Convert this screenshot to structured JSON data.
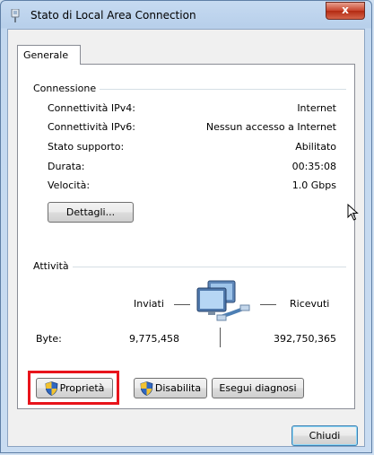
{
  "window": {
    "title": "Stato di Local Area Connection",
    "close_symbol": "x"
  },
  "tab": {
    "label": "Generale"
  },
  "connection": {
    "group_label": "Connessione",
    "rows": [
      {
        "label": "Connettività IPv4:",
        "value": "Internet"
      },
      {
        "label": "Connettività IPv6:",
        "value": "Nessun accesso a Internet"
      },
      {
        "label": "Stato supporto:",
        "value": "Abilitato"
      },
      {
        "label": "Durata:",
        "value": "00:35:08"
      },
      {
        "label": "Velocità:",
        "value": "1.0 Gbps"
      }
    ],
    "details_button": "Dettagli..."
  },
  "activity": {
    "group_label": "Attività",
    "sent_label": "Inviati",
    "received_label": "Ricevuti",
    "bytes_label": "Byte:",
    "bytes_sent": "9,775,458",
    "bytes_received": "392,750,365"
  },
  "buttons": {
    "properties": "Proprietà",
    "disable": "Disabilita",
    "diagnose": "Esegui diagnosi",
    "close": "Chiudi"
  },
  "colors": {
    "highlight": "#e8141c",
    "title_bar": "#c6daf1"
  }
}
